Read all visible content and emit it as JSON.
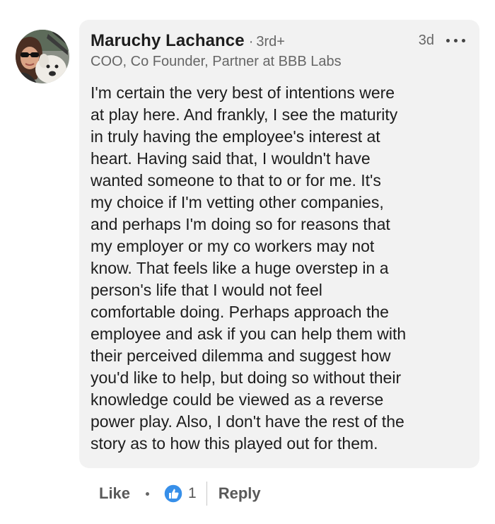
{
  "comment": {
    "author": {
      "name": "Maruchy Lachance",
      "degree_separator": "·",
      "degree": "3rd+",
      "headline": "COO, Co Founder, Partner at BBB Labs",
      "avatar_icon": "profile-photo-avatar"
    },
    "timestamp": "3d",
    "more_icon": "ellipsis-icon",
    "body_lines": [
      "I'm certain the very best of intentions were",
      "at play here. And frankly, I see the maturity",
      "in truly having the employee's interest at",
      "heart. Having said that, I wouldn't have",
      "wanted someone to that to or for me. It's",
      "my choice if I'm vetting other companies,",
      "and perhaps I'm doing so for reasons that",
      "my employer or my co workers may not",
      "know. That feels like a huge overstep in a",
      "person's life that I would not feel",
      "comfortable doing. Perhaps approach the",
      "employee and ask if you can help them with",
      "their perceived dilemma and suggest how",
      "you'd like to help, but doing so without their",
      "knowledge could be viewed as a reverse",
      "power play. Also, I don't have the rest of the",
      "story as to how this played out for them."
    ],
    "actions": {
      "like_label": "Like",
      "separator": "•",
      "reaction_icon": "like-thumbs-up-icon",
      "reaction_count": "1",
      "reply_label": "Reply"
    },
    "colors": {
      "bubble_bg": "#f2f2f2",
      "like_blue": "#378fe9",
      "secondary_text": "#666666"
    }
  }
}
